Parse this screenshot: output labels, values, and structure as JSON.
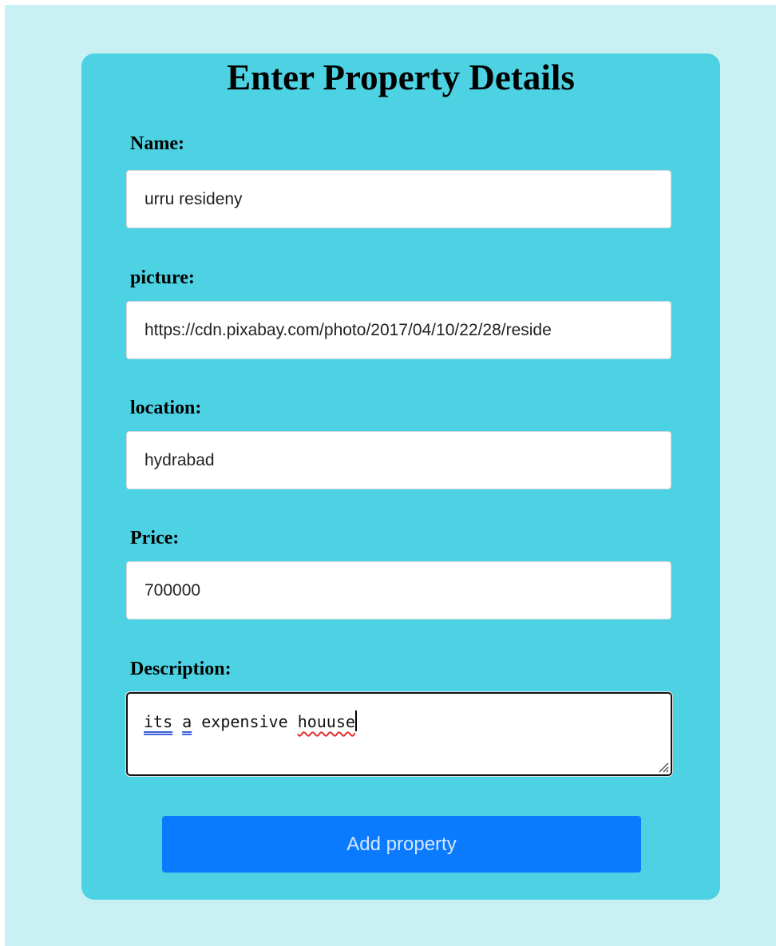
{
  "form": {
    "title": "Enter Property Details",
    "fields": {
      "name": {
        "label": "Name:",
        "value": "urru resideny"
      },
      "picture": {
        "label": "picture:",
        "value": "https://cdn.pixabay.com/photo/2017/04/10/22/28/reside"
      },
      "location": {
        "label": "location:",
        "value": "hydrabad"
      },
      "price": {
        "label": "Price:",
        "value": "700000"
      },
      "description": {
        "label": "Description:",
        "words": [
          "its",
          "a",
          "expensive",
          "houuse"
        ]
      }
    },
    "submit_label": "Add property"
  },
  "colors": {
    "page_background": "#c9f1f3",
    "card_background": "#4cd2e2",
    "button_background": "#0a7bff",
    "button_text": "#d7e7ff"
  }
}
